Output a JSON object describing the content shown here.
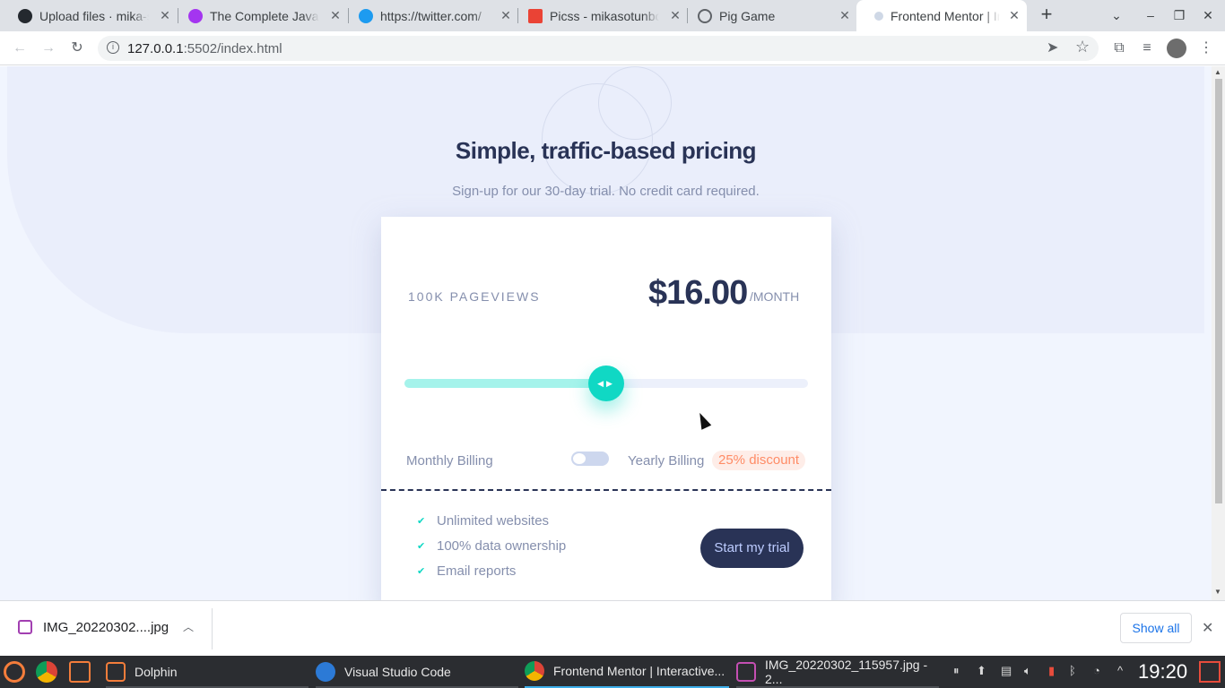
{
  "browser": {
    "tabs": [
      {
        "label": "Upload files · mika-so",
        "icon": "github-icon"
      },
      {
        "label": "The Complete JavaSc",
        "icon": "udemy-icon"
      },
      {
        "label": "https://twitter.com/",
        "icon": "twitter-icon"
      },
      {
        "label": "Picss - mikasotunbo",
        "icon": "gmail-icon"
      },
      {
        "label": "Pig Game",
        "icon": "globe-icon"
      },
      {
        "label": "Frontend Mentor | Ir",
        "icon": "frontendmentor-icon",
        "active": true
      }
    ],
    "url_host": "127.0.0.1",
    "url_path": ":5502/index.html"
  },
  "page": {
    "title": "Simple, traffic-based pricing",
    "subtitle": "Sign-up for our 30-day trial. No credit card required.",
    "pageviews": "100K PAGEVIEWS",
    "price": "$16.00",
    "per": "/MONTH",
    "slider_fraction": 0.5,
    "monthly_label": "Monthly Billing",
    "yearly_label": "Yearly Billing",
    "discount": "25% discount",
    "features": [
      "Unlimited websites",
      "100% data ownership",
      "Email reports"
    ],
    "cta": "Start my trial"
  },
  "downloads": {
    "file": "IMG_20220302....jpg",
    "show_all": "Show all"
  },
  "taskbar": {
    "tasks": [
      {
        "label": "Dolphin"
      },
      {
        "label": "Visual Studio Code"
      },
      {
        "label": "Frontend Mentor | Interactive..."
      },
      {
        "label": "IMG_20220302_115957.jpg - 2..."
      }
    ],
    "clock": "19:20"
  },
  "colors": {
    "accent": "#10d8c4",
    "dark": "#293356",
    "discount": "#ff8c66"
  }
}
